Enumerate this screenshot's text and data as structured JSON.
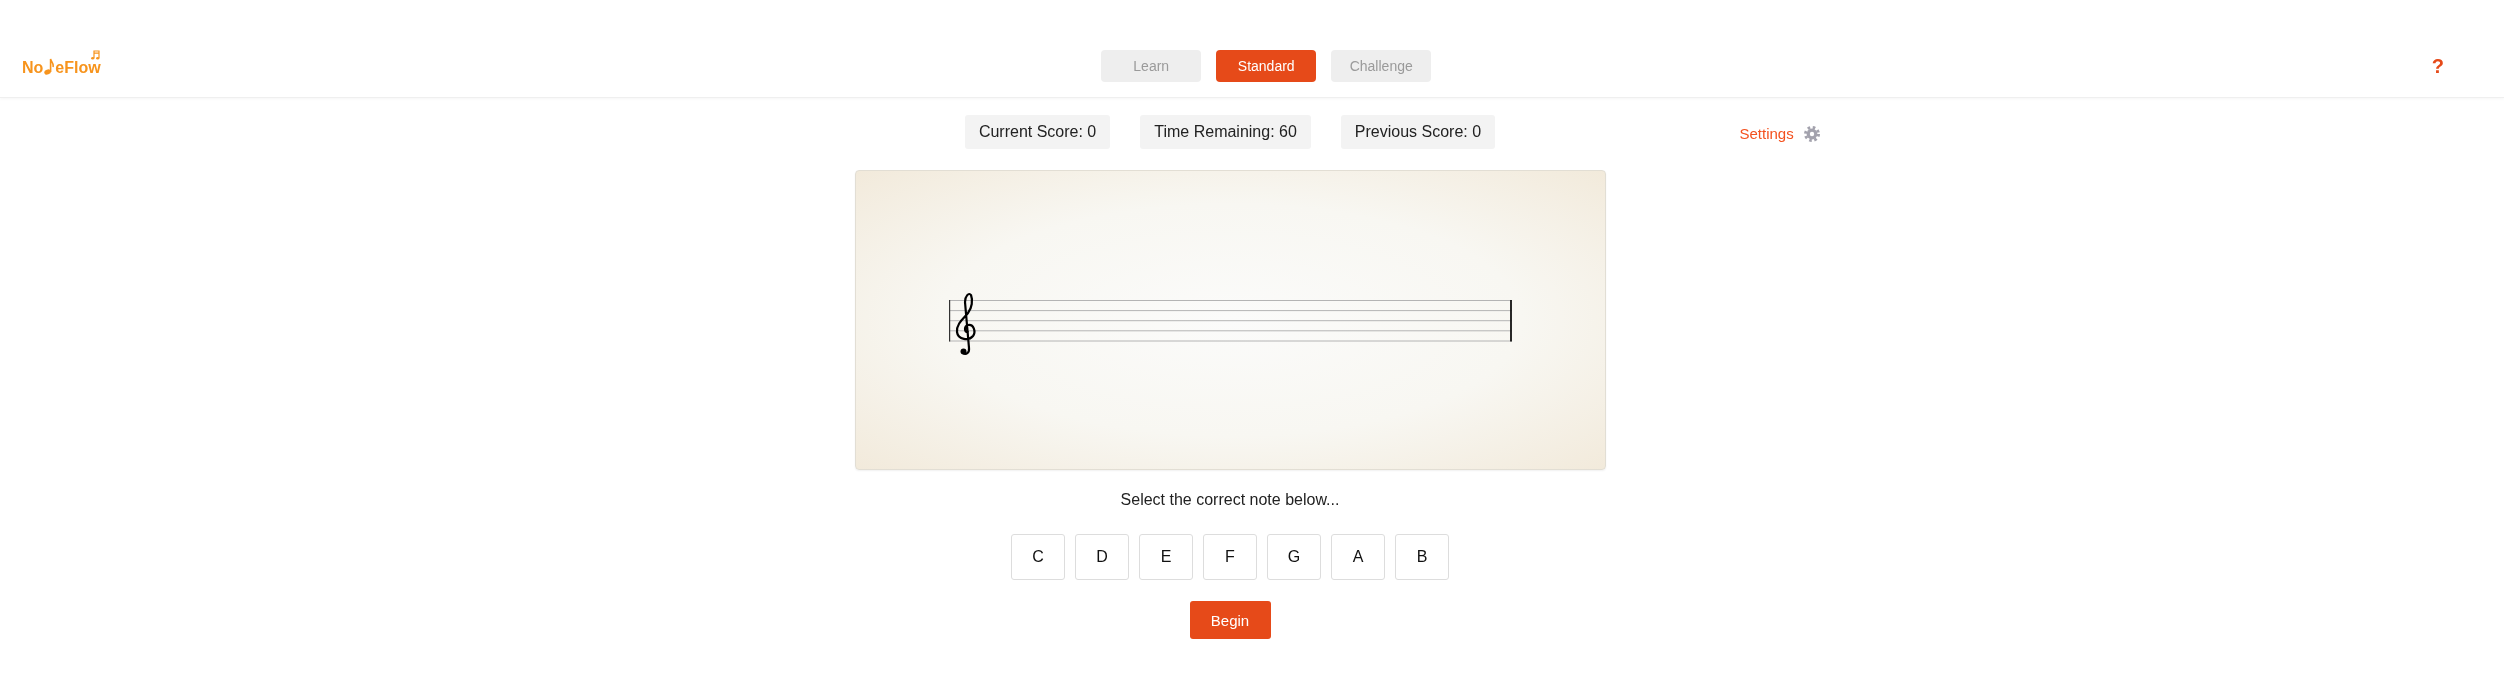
{
  "header": {
    "logo": {
      "before": "No",
      "after": "eFlow"
    },
    "modes": [
      {
        "label": "Learn",
        "selected": false
      },
      {
        "label": "Standard",
        "selected": true
      },
      {
        "label": "Challenge",
        "selected": false
      }
    ],
    "help": "?"
  },
  "scores": [
    "Current Score: 0",
    "Time Remaining: 60",
    "Previous Score: 0"
  ],
  "settings": {
    "label": "Settings"
  },
  "prompt": "Select the correct note below...",
  "notes": [
    "C",
    "D",
    "E",
    "F",
    "G",
    "A",
    "B"
  ],
  "start_button": "Begin"
}
